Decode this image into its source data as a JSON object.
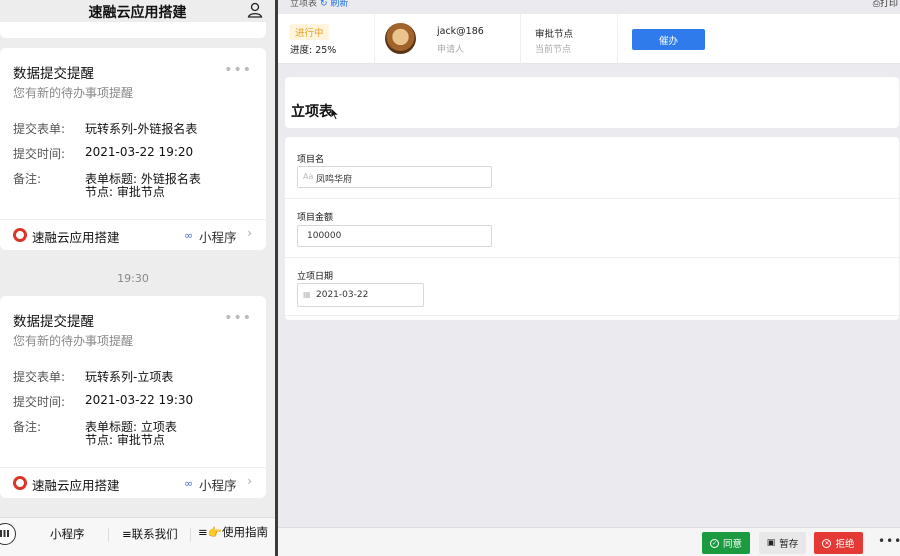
{
  "left": {
    "header_title": "速融云应用搭建",
    "time_separator": "19:30",
    "messages": [
      {
        "title": "数据提交提醒",
        "subtitle": "您有新的待办事项提醒",
        "more": "•••",
        "form_key": "提交表单:",
        "form_value": "玩转系列-外链报名表",
        "time_key": "提交时间:",
        "time_value": "2021-03-22 19:20",
        "note_key": "备注:",
        "note_line1": "表单标题: 外链报名表",
        "note_line2": "节点: 审批节点",
        "app_name": "速融云应用搭建",
        "mini_program": "小程序",
        "chevron": "›"
      },
      {
        "title": "数据提交提醒",
        "subtitle": "您有新的待办事项提醒",
        "more": "•••",
        "form_key": "提交表单:",
        "form_value": "玩转系列-立项表",
        "time_key": "提交时间:",
        "time_value": "2021-03-22 19:30",
        "note_key": "备注:",
        "note_line1": "表单标题: 立项表",
        "note_line2": "节点: 审批节点",
        "app_name": "速融云应用搭建",
        "mini_program": "小程序",
        "chevron": "›"
      }
    ],
    "bottom_bar": {
      "item1": "小程序",
      "item2": "≡联系我们",
      "item3": "≡👉使用指南"
    }
  },
  "right": {
    "breadcrumb": "立项表",
    "refresh": "↻ 刷新",
    "print": "⎙打印",
    "status_badge": "进行中",
    "progress": "进度: 25%",
    "applicant_name": "jack@186",
    "applicant_label": "申请人",
    "node_title": "审批节点",
    "node_label": "当前节点",
    "urge_button": "催办",
    "form_title": "立项表",
    "fields": {
      "name_label": "项目名",
      "name_value": "凤鸣华府",
      "amount_label": "项目金额",
      "amount_value": "100000",
      "date_label": "立项日期",
      "date_value": "2021-03-22"
    },
    "actions": {
      "agree": "同意",
      "save": "暂存",
      "reject": "拒绝",
      "more": "•••"
    }
  },
  "colors": {
    "primary": "#2f7bec",
    "agree": "#1c9a3f",
    "reject": "#e53935",
    "badge_text": "#e7a12a",
    "badge_bg": "#fff4dc"
  }
}
